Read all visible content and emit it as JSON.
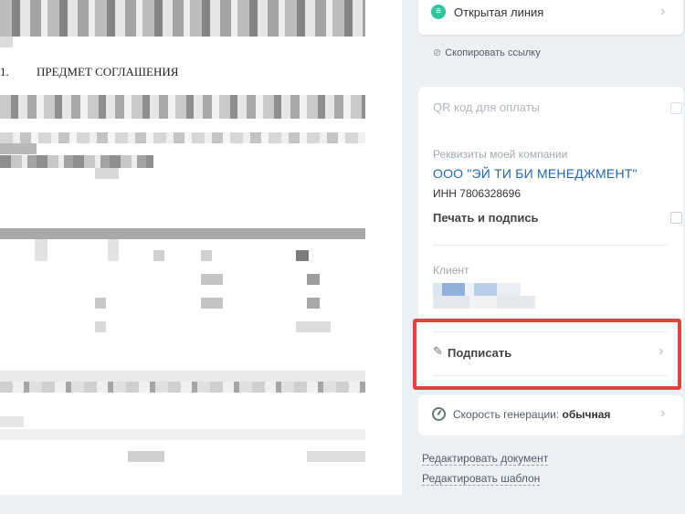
{
  "document": {
    "section_number": "1.",
    "section_title": "ПРЕДМЕТ СОГЛАШЕНИЯ"
  },
  "sidebar": {
    "open_line": {
      "label": "Открытая линия",
      "icon": "open-line-icon"
    },
    "copy_link": {
      "label": "Скопировать ссылку",
      "icon": "link-icon"
    },
    "qr": {
      "label": "QR код для оплаты",
      "checked": false
    },
    "my_company": {
      "caption": "Реквизиты моей компании",
      "name": "ООО \"ЭЙ ТИ БИ МЕНЕДЖМЕНТ\"",
      "inn": "ИНН 7806328696"
    },
    "stamp": {
      "label": "Печать и подпись",
      "checked": false
    },
    "client": {
      "caption": "Клиент"
    },
    "sign": {
      "label": "Подписать",
      "icon": "pen-icon"
    },
    "speed": {
      "label": "Скорость генерации:",
      "value": "обычная",
      "icon": "speedometer-icon"
    },
    "links": {
      "edit_document": "Редактировать документ",
      "edit_template": "Редактировать шаблон"
    }
  },
  "colors": {
    "accent_link": "#2067b0",
    "highlight": "#d9463f",
    "open_line_icon": "#2fc6a0"
  }
}
